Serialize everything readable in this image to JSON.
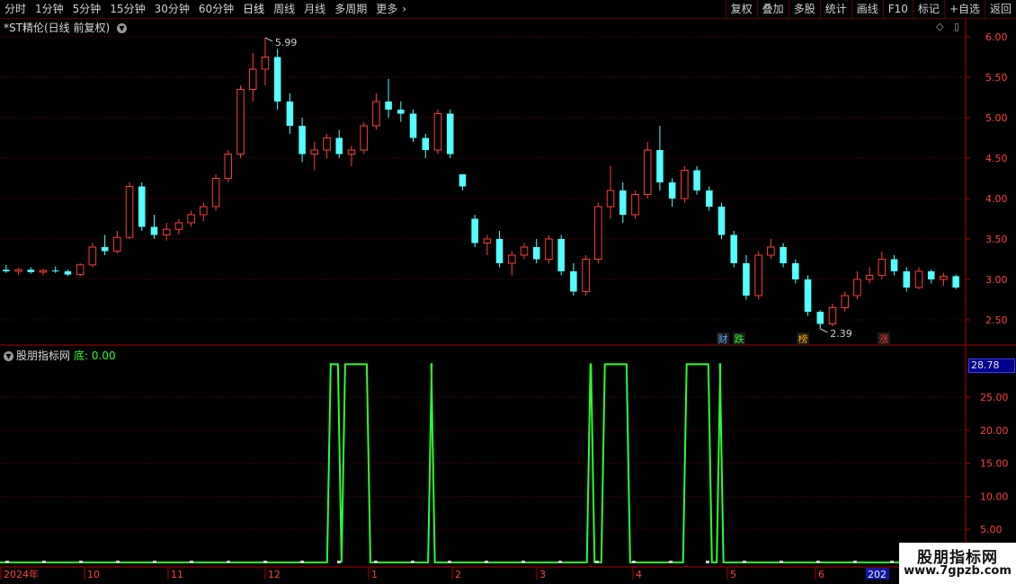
{
  "toolbar": {
    "periods": [
      "分时",
      "1分钟",
      "5分钟",
      "15分钟",
      "30分钟",
      "60分钟",
      "日线",
      "周线",
      "月线",
      "多周期",
      "更多"
    ],
    "active_period": "日线",
    "more_arrow": "›",
    "right_buttons": [
      "复权",
      "叠加",
      "多股",
      "统计",
      "画线",
      "F10",
      "标记",
      "+自选",
      "返回"
    ]
  },
  "main_panel": {
    "title": "*ST精伦(日线 前复权)",
    "price_axis": [
      "6.00",
      "5.50",
      "5.00",
      "4.50",
      "4.00",
      "3.50",
      "3.00",
      "2.50"
    ],
    "high_label": "5.99",
    "low_label": "2.39",
    "markers": [
      {
        "text": "财",
        "color": "#5fa8ff"
      },
      {
        "text": "跌",
        "color": "#2cff2c"
      },
      {
        "text": "榜",
        "color": "#ffaa00"
      },
      {
        "text": "涨",
        "color": "#ff3333"
      }
    ]
  },
  "sub_panel": {
    "title": "股朋指标网",
    "value_label": "底: 0.00",
    "axis": [
      "25.00",
      "20.00",
      "15.00",
      "10.00",
      "5.00"
    ],
    "current_value": "28.78"
  },
  "x_axis": {
    "labels": [
      "2024年",
      "10",
      "11",
      "12",
      "1",
      "2",
      "3",
      "4",
      "5",
      "6"
    ],
    "cut_label": "202"
  },
  "watermark": {
    "title": "股朋指标网",
    "url": "www.7gpzb.com"
  },
  "colors": {
    "up": "#ff3c3c",
    "down": "#54ffff",
    "indicator": "#2cff2c",
    "axis": "#b00000"
  },
  "chart_data": {
    "type": "candlestick",
    "y_range": [
      2.3,
      6.1
    ],
    "candles": [
      [
        3.12,
        3.18,
        3.08,
        3.1
      ],
      [
        3.1,
        3.14,
        3.06,
        3.12
      ],
      [
        3.12,
        3.15,
        3.07,
        3.09
      ],
      [
        3.09,
        3.13,
        3.05,
        3.11
      ],
      [
        3.11,
        3.16,
        3.08,
        3.1
      ],
      [
        3.1,
        3.12,
        3.04,
        3.06
      ],
      [
        3.06,
        3.2,
        3.04,
        3.18
      ],
      [
        3.18,
        3.45,
        3.15,
        3.4
      ],
      [
        3.4,
        3.55,
        3.3,
        3.35
      ],
      [
        3.35,
        3.6,
        3.32,
        3.52
      ],
      [
        3.52,
        4.2,
        3.5,
        4.15
      ],
      [
        4.15,
        4.2,
        3.6,
        3.65
      ],
      [
        3.65,
        3.8,
        3.5,
        3.55
      ],
      [
        3.55,
        3.7,
        3.48,
        3.62
      ],
      [
        3.62,
        3.75,
        3.55,
        3.7
      ],
      [
        3.7,
        3.85,
        3.65,
        3.8
      ],
      [
        3.8,
        3.95,
        3.72,
        3.9
      ],
      [
        3.9,
        4.3,
        3.85,
        4.25
      ],
      [
        4.25,
        4.6,
        4.2,
        4.55
      ],
      [
        4.55,
        5.4,
        4.5,
        5.35
      ],
      [
        5.35,
        5.8,
        5.2,
        5.6
      ],
      [
        5.6,
        5.99,
        5.4,
        5.75
      ],
      [
        5.75,
        5.85,
        5.1,
        5.2
      ],
      [
        5.2,
        5.3,
        4.8,
        4.9
      ],
      [
        4.9,
        5.0,
        4.45,
        4.55
      ],
      [
        4.55,
        4.7,
        4.35,
        4.6
      ],
      [
        4.6,
        4.8,
        4.5,
        4.75
      ],
      [
        4.75,
        4.85,
        4.5,
        4.55
      ],
      [
        4.55,
        4.65,
        4.4,
        4.6
      ],
      [
        4.6,
        4.95,
        4.55,
        4.9
      ],
      [
        4.9,
        5.3,
        4.85,
        5.2
      ],
      [
        5.2,
        5.48,
        5.0,
        5.1
      ],
      [
        5.1,
        5.2,
        4.95,
        5.05
      ],
      [
        5.05,
        5.1,
        4.7,
        4.75
      ],
      [
        4.75,
        4.8,
        4.5,
        4.6
      ],
      [
        4.6,
        5.1,
        4.55,
        5.05
      ],
      [
        5.05,
        5.1,
        4.5,
        4.55
      ],
      [
        4.3,
        4.3,
        4.1,
        4.15
      ],
      [
        3.75,
        3.8,
        3.4,
        3.45
      ],
      [
        3.45,
        3.55,
        3.3,
        3.5
      ],
      [
        3.5,
        3.6,
        3.15,
        3.2
      ],
      [
        3.2,
        3.35,
        3.05,
        3.3
      ],
      [
        3.3,
        3.45,
        3.25,
        3.4
      ],
      [
        3.4,
        3.5,
        3.2,
        3.25
      ],
      [
        3.25,
        3.55,
        3.2,
        3.5
      ],
      [
        3.5,
        3.55,
        3.05,
        3.1
      ],
      [
        3.1,
        3.2,
        2.8,
        2.85
      ],
      [
        2.85,
        3.3,
        2.8,
        3.25
      ],
      [
        3.25,
        3.95,
        3.2,
        3.9
      ],
      [
        3.9,
        4.4,
        3.75,
        4.1
      ],
      [
        4.1,
        4.2,
        3.7,
        3.8
      ],
      [
        3.8,
        4.1,
        3.75,
        4.05
      ],
      [
        4.05,
        4.7,
        4.0,
        4.6
      ],
      [
        4.6,
        4.9,
        4.1,
        4.2
      ],
      [
        4.2,
        4.25,
        3.9,
        4.0
      ],
      [
        4.0,
        4.4,
        3.95,
        4.35
      ],
      [
        4.35,
        4.4,
        4.05,
        4.1
      ],
      [
        4.1,
        4.15,
        3.85,
        3.9
      ],
      [
        3.9,
        3.95,
        3.5,
        3.55
      ],
      [
        3.55,
        3.6,
        3.15,
        3.2
      ],
      [
        3.2,
        3.3,
        2.75,
        2.8
      ],
      [
        2.8,
        3.35,
        2.75,
        3.3
      ],
      [
        3.3,
        3.5,
        3.25,
        3.4
      ],
      [
        3.4,
        3.45,
        3.15,
        3.2
      ],
      [
        3.2,
        3.25,
        2.95,
        3.0
      ],
      [
        3.0,
        3.05,
        2.55,
        2.6
      ],
      [
        2.6,
        2.62,
        2.39,
        2.45
      ],
      [
        2.45,
        2.7,
        2.42,
        2.65
      ],
      [
        2.65,
        2.85,
        2.6,
        2.8
      ],
      [
        2.8,
        3.1,
        2.75,
        3.0
      ],
      [
        3.0,
        3.15,
        2.95,
        3.05
      ],
      [
        3.05,
        3.35,
        3.0,
        3.25
      ],
      [
        3.25,
        3.3,
        3.05,
        3.1
      ],
      [
        3.1,
        3.15,
        2.85,
        2.9
      ],
      [
        2.9,
        3.15,
        2.88,
        3.1
      ],
      [
        3.1,
        3.12,
        2.95,
        3.0
      ],
      [
        3.0,
        3.08,
        2.92,
        3.04
      ],
      [
        3.04,
        3.06,
        2.88,
        2.9
      ]
    ],
    "indicator": {
      "name": "股朋指标网",
      "y_range": [
        0,
        31
      ],
      "pulses": [
        [
          0.34,
          0.355
        ],
        [
          0.355,
          0.385
        ],
        [
          0.445,
          0.452
        ],
        [
          0.61,
          0.618
        ],
        [
          0.625,
          0.655
        ],
        [
          0.71,
          0.74
        ],
        [
          0.745,
          0.752
        ]
      ],
      "high": 30,
      "low": 0
    }
  }
}
